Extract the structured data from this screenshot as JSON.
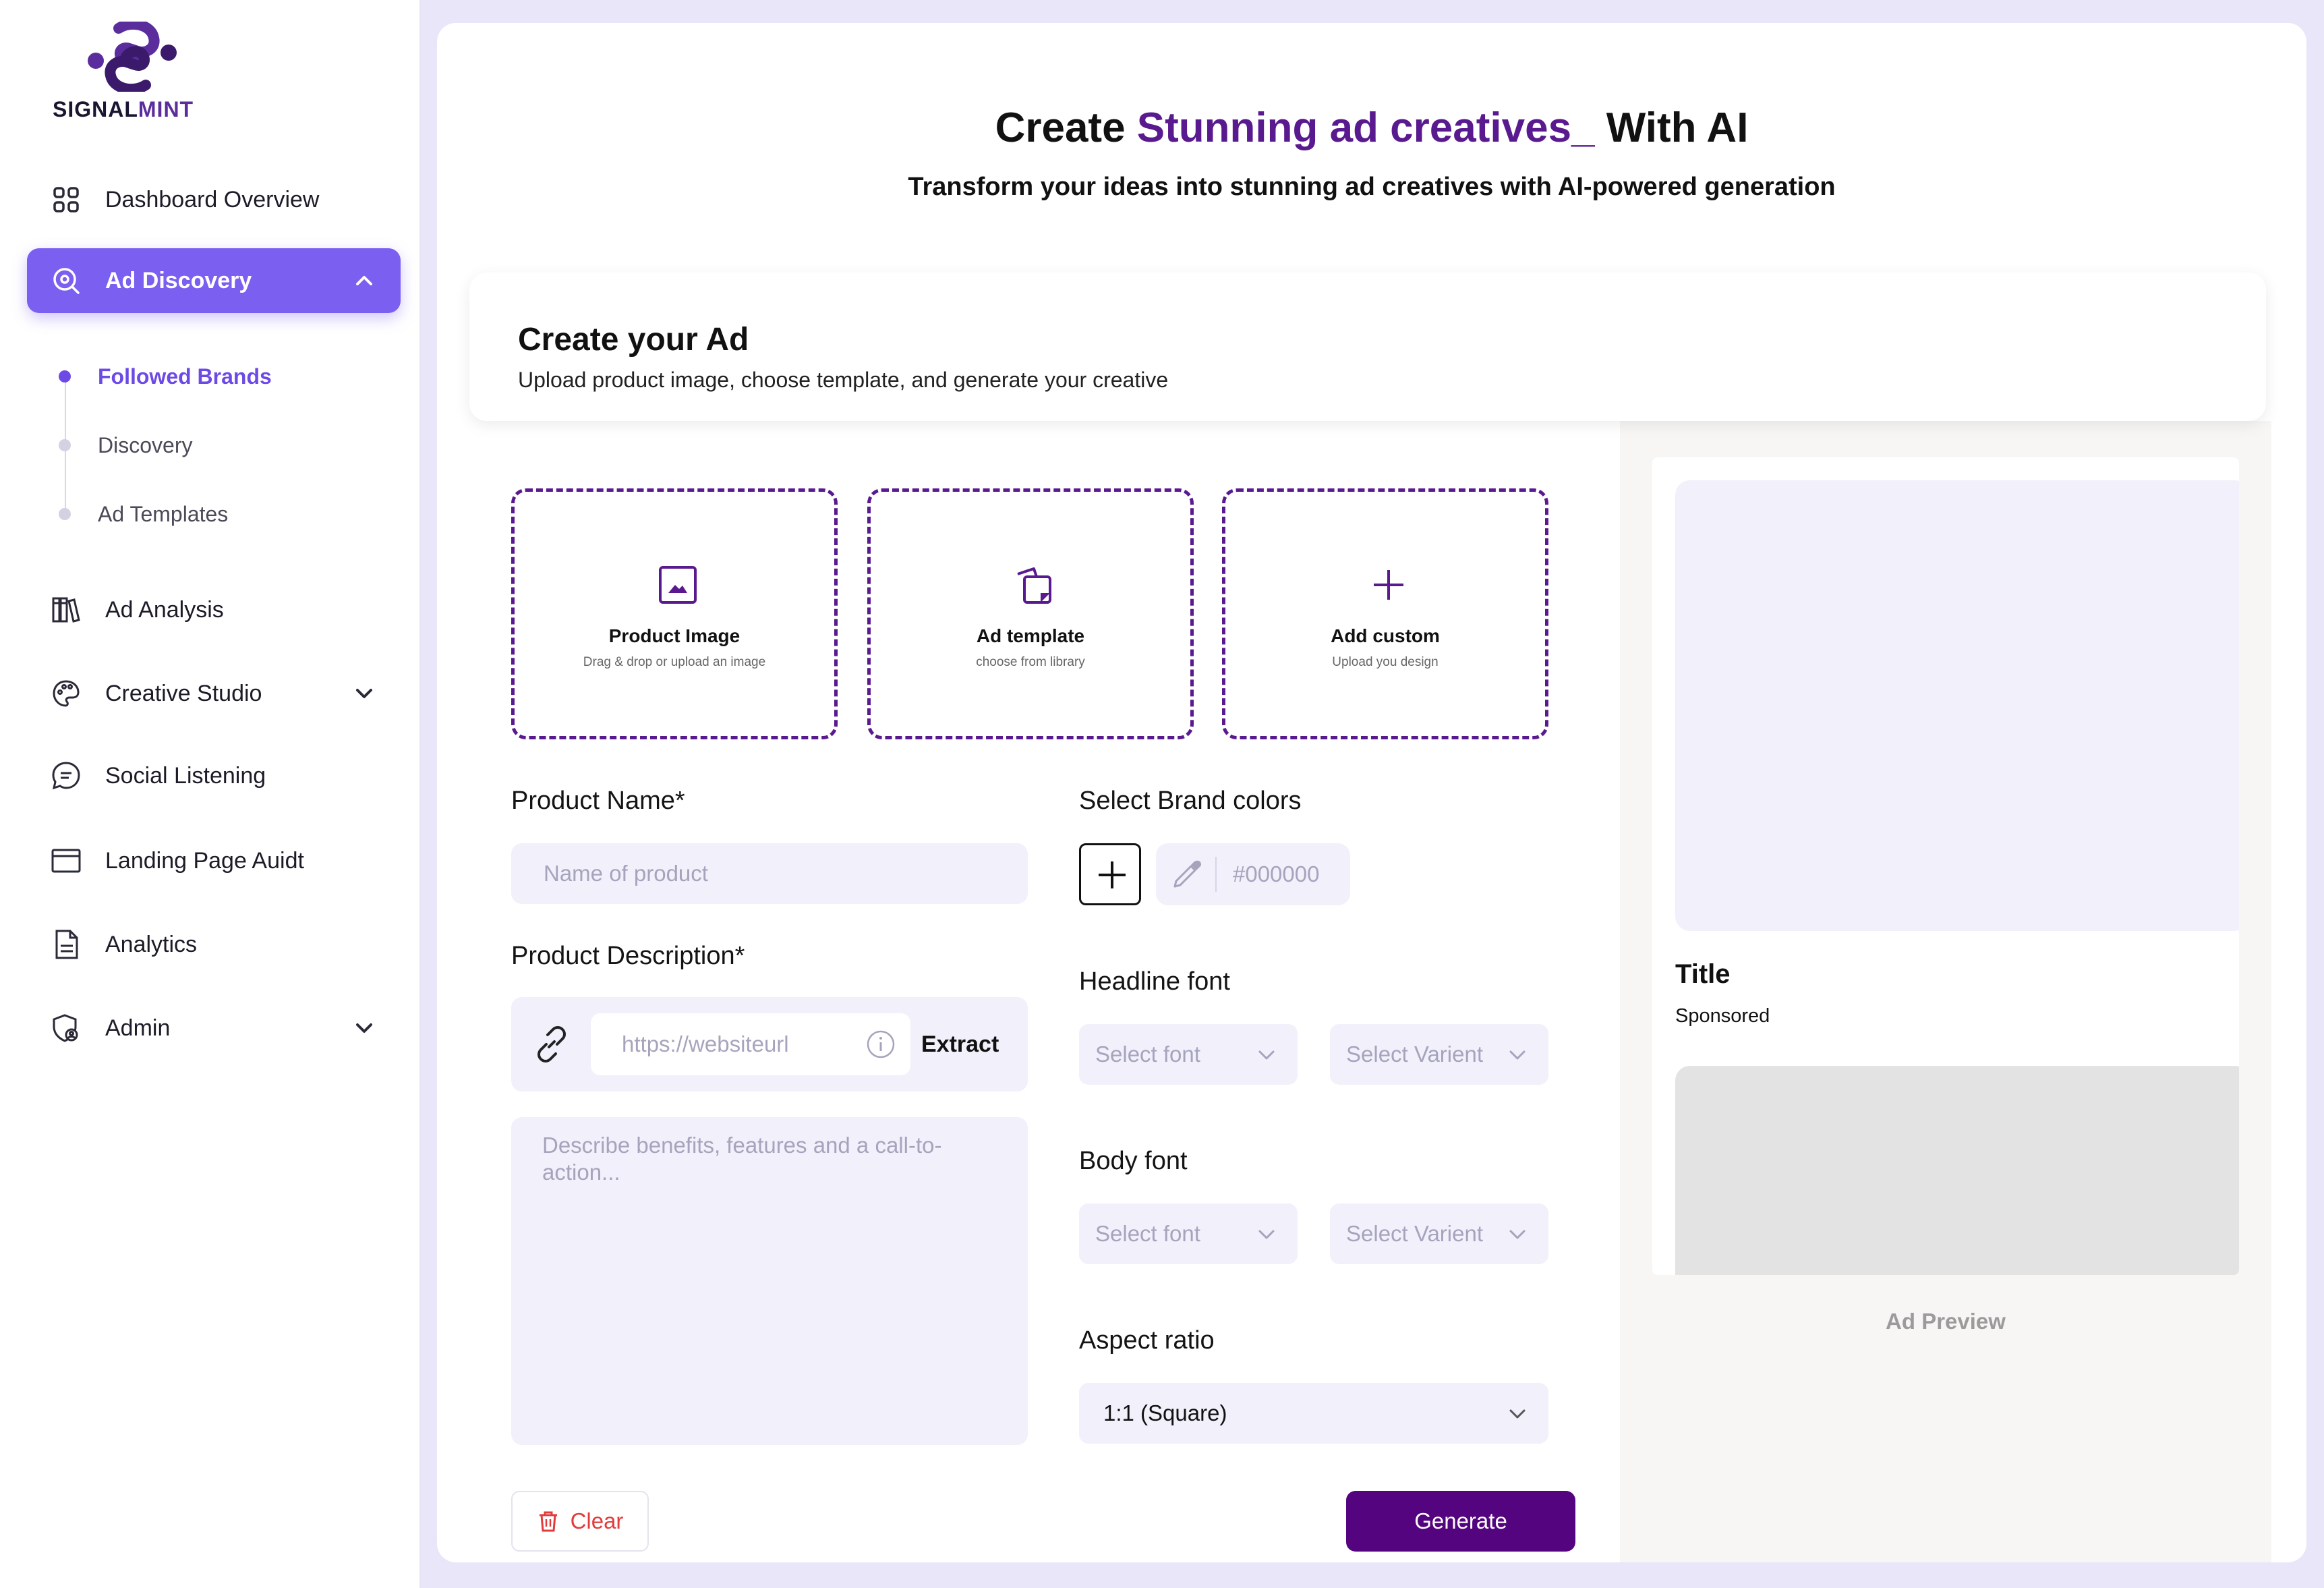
{
  "brand": {
    "logo_word_signal": "SIGNAL",
    "logo_word_mint": "MINT"
  },
  "sidebar": {
    "items": [
      {
        "label": "Dashboard Overview",
        "icon": "grid-icon"
      },
      {
        "label": "Ad Discovery",
        "icon": "search-discovery-icon",
        "active": true,
        "expanded": true
      },
      {
        "label": "Ad Analysis",
        "icon": "books-icon"
      },
      {
        "label": "Creative Studio",
        "icon": "palette-icon",
        "has_submenu": true
      },
      {
        "label": "Social Listening",
        "icon": "chat-icon"
      },
      {
        "label": "Landing Page Auidt",
        "icon": "browser-icon"
      },
      {
        "label": "Analytics",
        "icon": "document-icon"
      },
      {
        "label": "Admin",
        "icon": "shield-icon",
        "has_submenu": true
      }
    ],
    "subitems": [
      {
        "label": "Followed Brands",
        "active": true
      },
      {
        "label": "Discovery"
      },
      {
        "label": "Ad Templates"
      }
    ]
  },
  "hero": {
    "title_prefix": "Create ",
    "title_accent": "Stunning ad creatives_",
    "title_suffix": " With AI",
    "subtitle": "Transform your ideas into stunning ad creatives with AI-powered generation"
  },
  "create_card": {
    "title": "Create your Ad",
    "subtitle": "Upload product image, choose template, and generate your creative"
  },
  "uploads": [
    {
      "label": "Product Image",
      "sub": "Drag & drop or upload an image",
      "icon": "image-icon"
    },
    {
      "label": "Ad template",
      "sub": "choose from library",
      "icon": "template-icon"
    },
    {
      "label": "Add custom",
      "sub": "Upload you design",
      "icon": "plus-icon"
    }
  ],
  "form": {
    "product_name_label": "Product Name*",
    "product_name_placeholder": "Name of product",
    "product_desc_label": "Product Description*",
    "url_placeholder": "https://websiteurl",
    "extract_label": "Extract",
    "desc_placeholder": "Describe benefits, features and a call-to-action...",
    "brand_colors_label": "Select Brand colors",
    "color_hex_placeholder": "#000000",
    "headline_font_label": "Headline font",
    "body_font_label": "Body font",
    "select_font": "Select font",
    "select_variant": "Select Varient",
    "aspect_ratio_label": "Aspect ratio",
    "aspect_ratio_value": "1:1 (Square)",
    "clear_label": "Clear",
    "generate_label": "Generate"
  },
  "preview": {
    "title": "Title",
    "sponsored": "Sponsored",
    "label": "Ad Preview"
  },
  "colors": {
    "accent": "#7b5ff0",
    "brand_purple": "#5a1a8f",
    "generate_bg": "#54047e",
    "danger": "#e33b3b"
  }
}
